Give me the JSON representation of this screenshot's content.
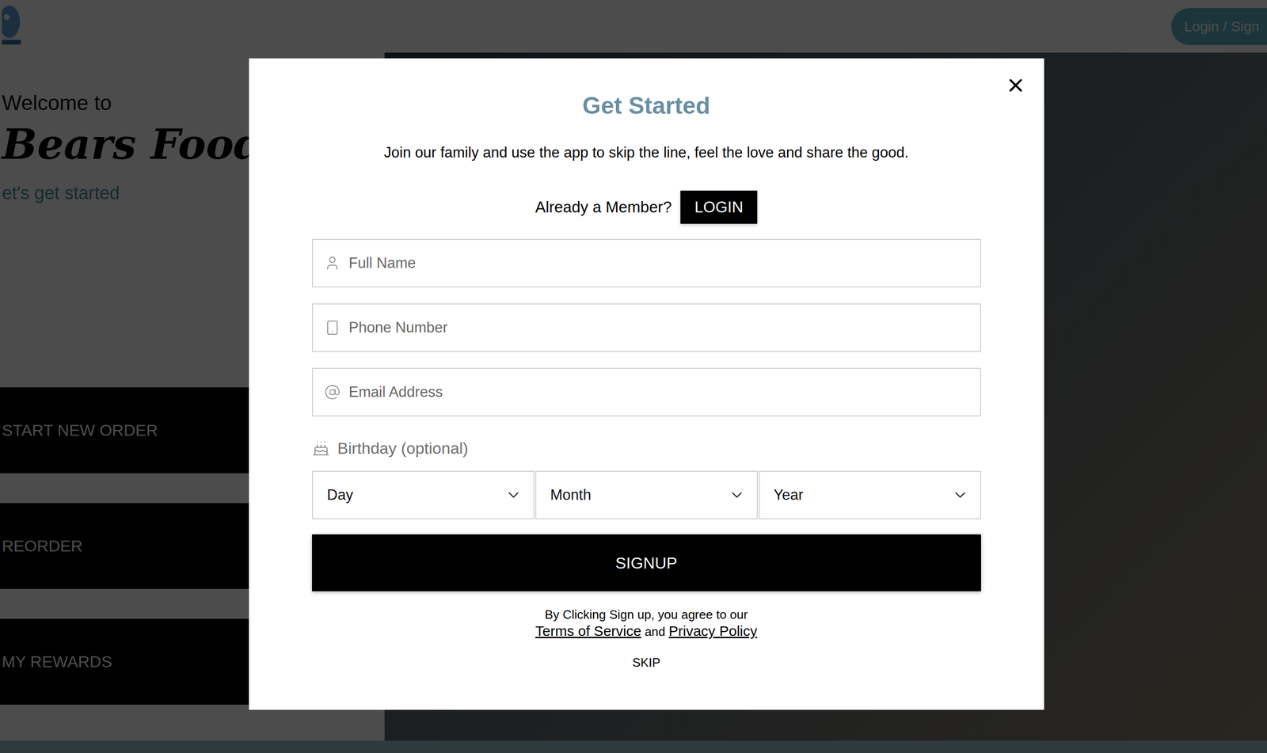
{
  "header": {
    "login_button": "Login / Sign"
  },
  "welcome": {
    "greeting": "Welcome to",
    "brand": "Bears Food Sha",
    "tagline": "et's get started"
  },
  "actions": [
    "START NEW ORDER",
    "REORDER",
    "MY REWARDS"
  ],
  "modal": {
    "title": "Get Started",
    "subtitle": "Join our family and use the app to skip the line, feel the love and share the good.",
    "member_prompt": "Already a Member?",
    "login": "LOGIN",
    "fields": [
      {
        "placeholder": "Full Name",
        "kind": "name"
      },
      {
        "placeholder": "Phone Number",
        "kind": "phone"
      },
      {
        "placeholder": "Email Address",
        "kind": "email"
      }
    ],
    "birthday": {
      "label": "Birthday (optional)",
      "selects": [
        "Day",
        "Month",
        "Year"
      ]
    },
    "submit": "SIGNUP",
    "terms": {
      "prefix": "By Clicking Sign up, you agree to our",
      "tos": "Terms of Service",
      "and": "and",
      "privacy": "Privacy Policy"
    },
    "skip": "SKIP"
  }
}
